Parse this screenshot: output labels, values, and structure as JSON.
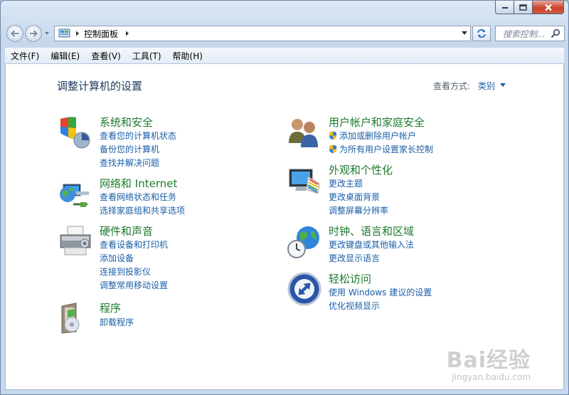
{
  "window": {
    "caption": {
      "minimize_icon": "minimize-icon",
      "maximize_icon": "maximize-icon",
      "close_icon": "close-icon"
    }
  },
  "navigation": {
    "back_icon": "back-arrow-icon",
    "forward_icon": "forward-arrow-icon",
    "address": {
      "breadcrumb": [
        "控制面板"
      ],
      "icon": "control-panel-icon"
    },
    "search": {
      "placeholder": "搜索控制..."
    }
  },
  "menubar": {
    "items": [
      "文件(F)",
      "编辑(E)",
      "查看(V)",
      "工具(T)",
      "帮助(H)"
    ]
  },
  "main": {
    "title": "调整计算机的设置",
    "view_by_label": "查看方式:",
    "view_by_value": "类别"
  },
  "categories": [
    {
      "icon": "security-shield-icon",
      "title": "系统和安全",
      "links": [
        "查看您的计算机状态",
        "备份您的计算机",
        "查找并解决问题"
      ]
    },
    {
      "icon": "network-globe-icon",
      "title": "网络和 Internet",
      "links": [
        "查看网络状态和任务",
        "选择家庭组和共享选项"
      ]
    },
    {
      "icon": "printer-icon",
      "title": "硬件和声音",
      "links": [
        "查看设备和打印机",
        "添加设备",
        "连接到投影仪",
        "调整常用移动设置"
      ]
    },
    {
      "icon": "programs-disc-icon",
      "title": "程序",
      "links": [
        "卸载程序"
      ]
    },
    {
      "icon": "users-icon",
      "title": "用户帐户和家庭安全",
      "links": [
        "添加或删除用户帐户",
        "为所有用户设置家长控制"
      ]
    },
    {
      "icon": "monitor-palette-icon",
      "title": "外观和个性化",
      "links": [
        "更改主题",
        "更改桌面背景",
        "调整屏幕分辨率"
      ]
    },
    {
      "icon": "clock-globe-icon",
      "title": "时钟、语言和区域",
      "links": [
        "更改键盘或其他输入法",
        "更改显示语言"
      ]
    },
    {
      "icon": "accessibility-icon",
      "title": "轻松访问",
      "links": [
        "使用 Windows 建议的设置",
        "优化视频显示"
      ]
    }
  ],
  "watermark": {
    "logo": "Bai经验",
    "url": "jingyan.baidu.com"
  },
  "colors": {
    "category_title": "#1e7a2e",
    "link": "#1a5ea8",
    "heading": "#1e395b"
  }
}
